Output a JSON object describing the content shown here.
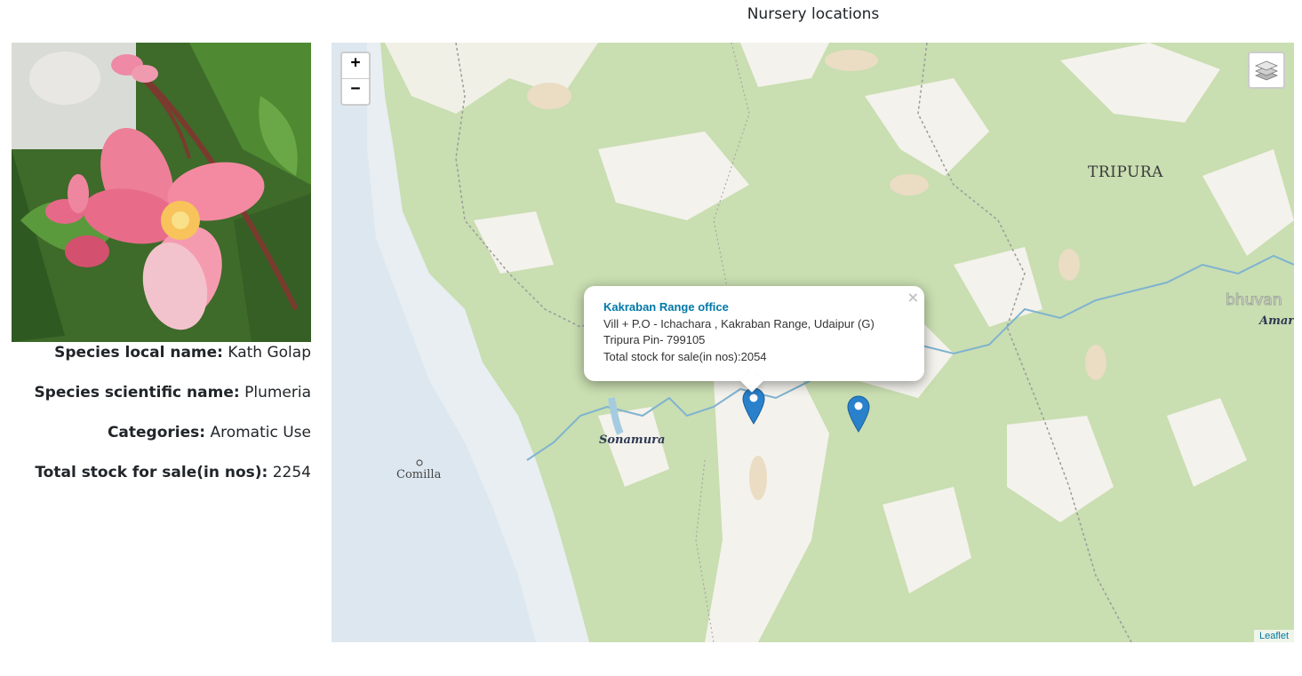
{
  "page": {
    "title": "Nursery locations"
  },
  "species": {
    "photo_icon": "plumeria-flower-photo",
    "local_name_label": "Species local name:",
    "local_name": "Kath Golap",
    "scientific_name_label": "Species scientific name:",
    "scientific_name": "Plumeria",
    "categories_label": "Categories:",
    "categories": "Aromatic Use",
    "total_stock_label": "Total stock for sale(in nos):",
    "total_stock": "2254"
  },
  "map": {
    "zoom_in": "+",
    "zoom_out": "−",
    "layers_icon": "layers-icon",
    "attribution": "Leaflet",
    "places": {
      "tripura": "TRIPURA",
      "sonamura": "Sonamura",
      "comilla": "Comilla",
      "amar": "Amar",
      "bhuvan": "bhuvan"
    },
    "popup": {
      "title": "Kakraban Range office",
      "address_line1": "Vill + P.O - Ichachara , Kakraban Range, Udaipur (G)",
      "address_line2": "Tripura Pin- 799105",
      "stock_line": "Total stock for sale(in nos):2054",
      "close": "×"
    },
    "markers": [
      "nursery-marker-kakraban",
      "nursery-marker-2"
    ],
    "colors": {
      "marker": "#2a81cb",
      "forest": "#c9deb1",
      "open_land": "#f4f2ec",
      "water": "#dde7ef",
      "river": "#7fb3d0"
    }
  }
}
